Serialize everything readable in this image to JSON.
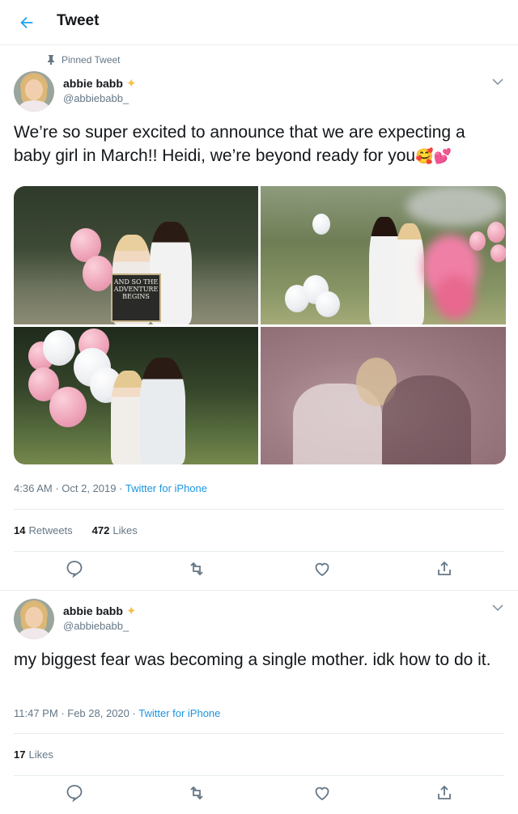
{
  "header": {
    "title": "Tweet"
  },
  "tweet1": {
    "pinned_label": "Pinned Tweet",
    "author_name": "abbie babb",
    "handle": "@abbiebabb_",
    "text": "We’re so super excited to announce that we are expecting a baby girl in March!! Heidi, we’re beyond ready for you",
    "emoji": "🥰💕",
    "sign_text": "AND SO THE ADVENTURE BEGINS",
    "time": "4:36 AM",
    "date": "Oct 2, 2019",
    "source": "Twitter for iPhone",
    "retweets_count": "14",
    "retweets_label": "Retweets",
    "likes_count": "472",
    "likes_label": "Likes"
  },
  "tweet2": {
    "author_name": "abbie babb",
    "handle": "@abbiebabb_",
    "text": "my biggest fear was becoming a single mother. idk how to do it.",
    "time": "11:47 PM",
    "date": "Feb 28, 2020",
    "source": "Twitter for iPhone",
    "likes_count": "17",
    "likes_label": "Likes"
  },
  "icons": {
    "back": "arrow-left-icon",
    "pin": "pin-icon",
    "chevron": "chevron-down-icon",
    "reply": "reply-icon",
    "retweet": "retweet-icon",
    "like": "heart-icon",
    "share": "share-icon"
  },
  "colors": {
    "accent": "#1da1f2",
    "secondary_text": "#657786",
    "divider": "#e6ecf0"
  }
}
